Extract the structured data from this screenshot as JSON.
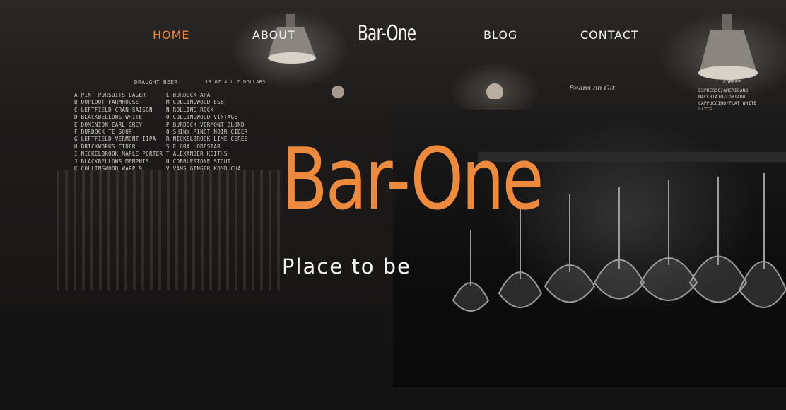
{
  "nav": {
    "home": "HOME",
    "about": "ABOUT",
    "logo": "Bar-One",
    "blog": "BLOG",
    "contact": "CONTACT"
  },
  "hero": {
    "title": "Bar-One",
    "subtitle": "Place to be"
  },
  "menu_board": {
    "title": "DRAUGHT  BEER",
    "price_note": "13 OZ   ALL 7 DOLLARS",
    "left": [
      "A PINT PURSUITS  LAGER",
      "B OOPLOOT  FARMHOUSE",
      "C LEFTFIELD CRAN SAISON",
      "D BLACKBELLOWS  WHITE",
      "E DOMINION EARL GREY",
      "F BURDOCK TE  SOUR",
      "G LEFTFIELD VERMONT IIPA",
      "H BRICKWORKS  CIDER",
      "I NICKELBROOK MAPLE PORTER",
      "J BLACKBELLOWS MEMPHIS",
      "K COLLINGWOOD WARP 9"
    ],
    "right": [
      "L BURDOCK  APA",
      "M COLLINGWOOD ESB",
      "N ROLLING ROCK",
      "O COLLINGWOOD VINTAGE",
      "P BURDOCK VERMONT BLOND",
      "Q SHINY PINOT NOIR CIDER",
      "R NICKELBROOK LIME CERES",
      "S ELORA LODESTAR",
      "T ALEXANDER  KEITHS",
      "U COBBLESTONE STOUT",
      "V VAMS GINGER KOMBUCHA"
    ]
  },
  "coffee_board": {
    "title": "COFFEE",
    "items": [
      "ESPRESSO/AMERICANO",
      "MACCHIATO/CORTADO",
      "CAPPUCCINO/FLAT WHITE",
      "LATTE"
    ]
  },
  "beans_sign": "Beans on Git"
}
